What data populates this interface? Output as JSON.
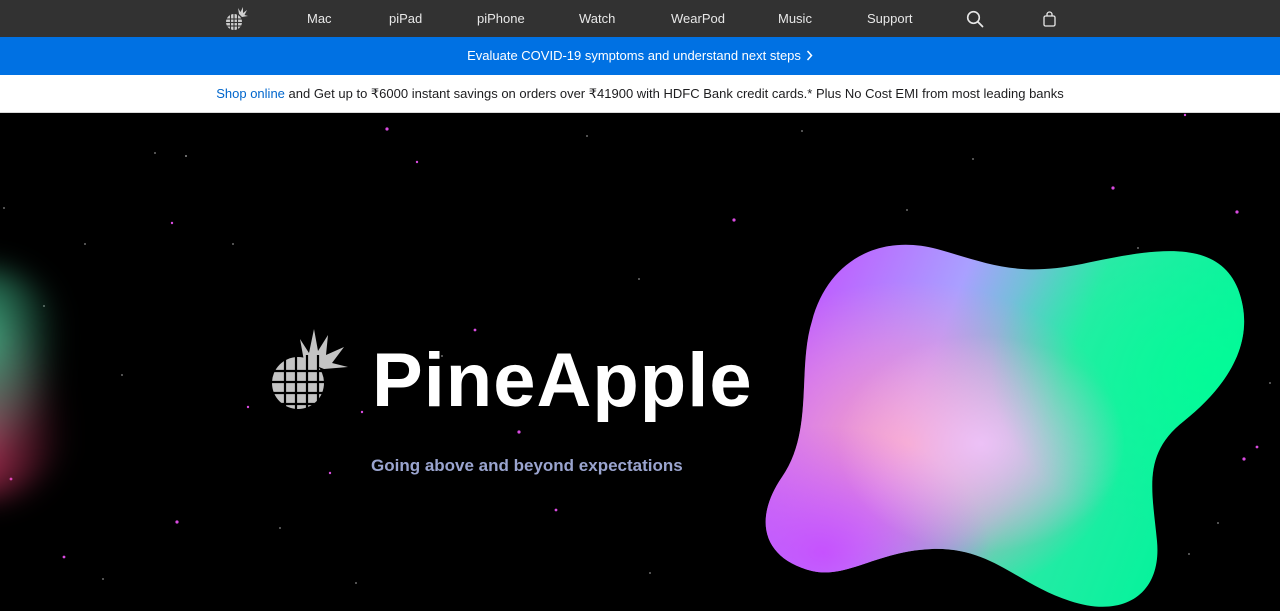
{
  "nav": {
    "logo_icon": "pineapple-logo-icon",
    "items": [
      {
        "label": "Mac"
      },
      {
        "label": "piPad"
      },
      {
        "label": "piPhone"
      },
      {
        "label": "Watch"
      },
      {
        "label": "WearPod"
      },
      {
        "label": "Music"
      },
      {
        "label": "Support"
      }
    ],
    "search_icon": "search-icon",
    "bag_icon": "shopping-bag-icon"
  },
  "banner": {
    "text": "Evaluate COVID-19 symptoms and understand next steps",
    "chevron_icon": "chevron-right-icon"
  },
  "promo": {
    "link_text": "Shop online",
    "text": " and Get up to ₹6000 instant savings on orders over ₹41900 with HDFC Bank credit cards.* Plus No Cost EMI from most leading banks"
  },
  "hero": {
    "title": "PineApple",
    "tagline": "Going above and beyond expectations",
    "logo_icon": "pineapple-logo-icon"
  },
  "colors": {
    "nav_bg": "#323232",
    "banner_bg": "#0071e3",
    "link": "#0066cc",
    "hero_bg": "#000000",
    "tagline": "#9aa4cf"
  }
}
